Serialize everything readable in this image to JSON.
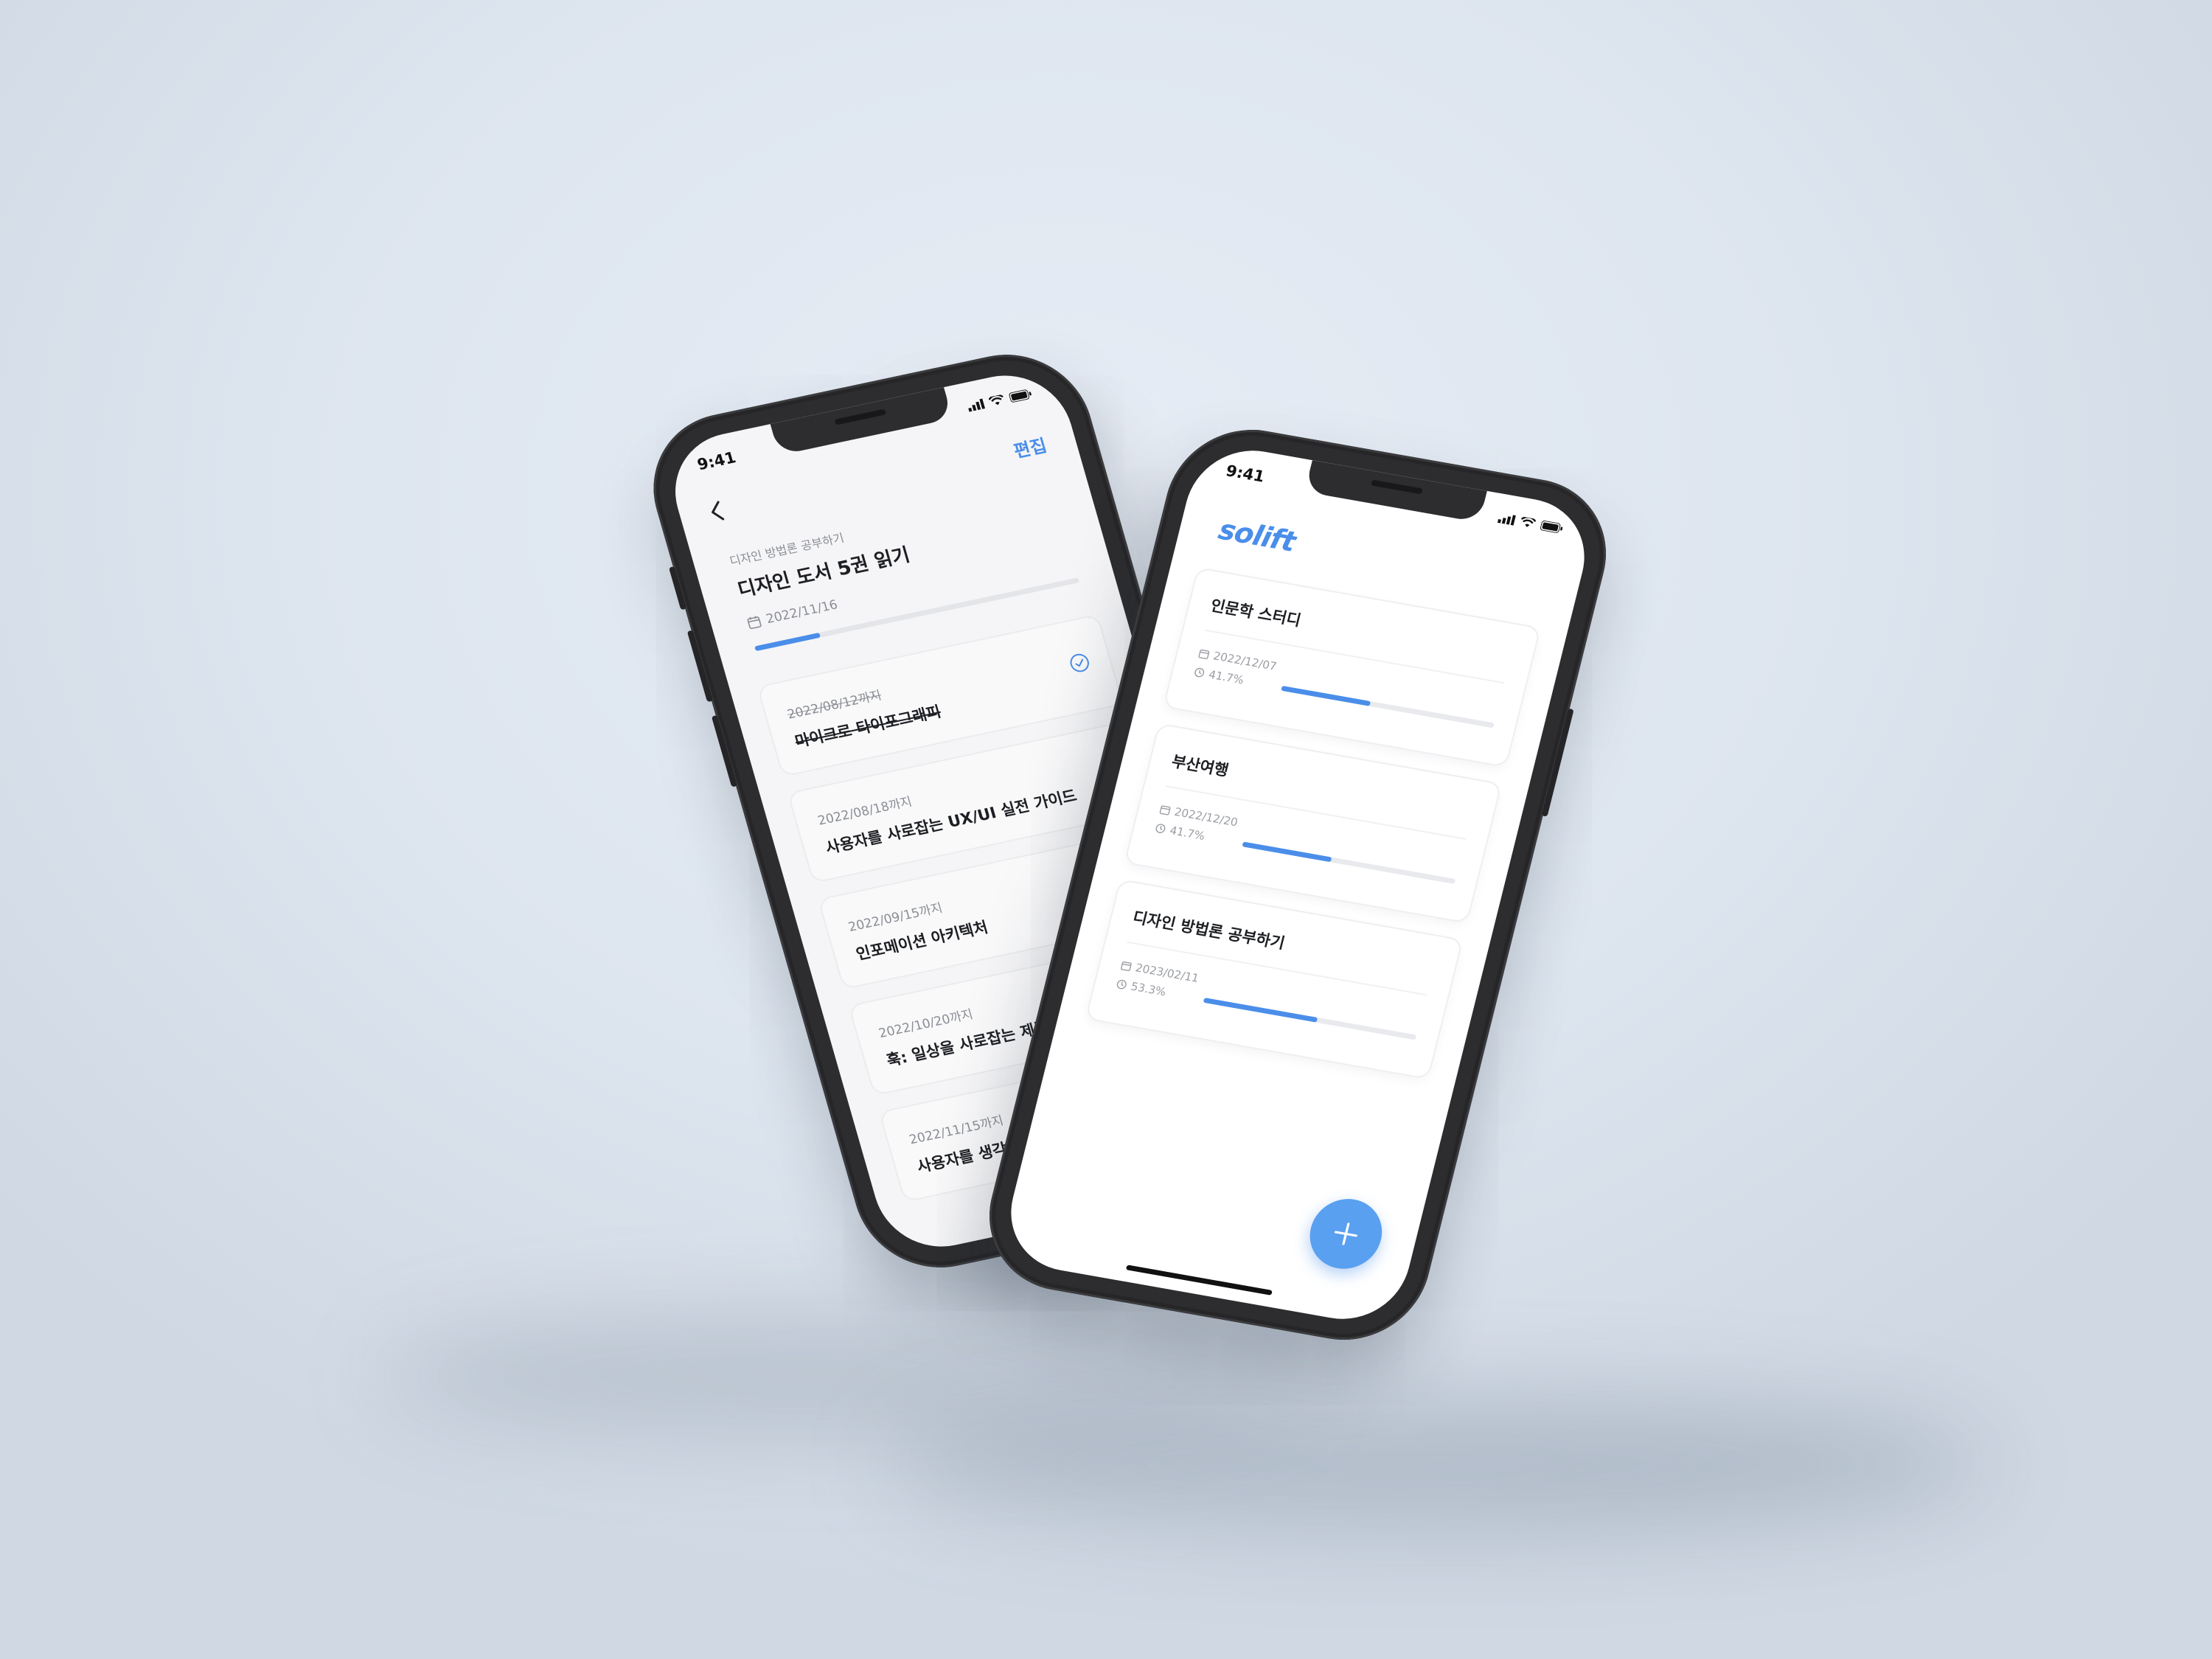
{
  "status_bar": {
    "time": "9:41"
  },
  "detail_screen": {
    "nav": {
      "edit_label": "편집"
    },
    "parent_goal": "디자인 방법론 공부하기",
    "title": "디자인 도서 5권 읽기",
    "date": "2022/11/16",
    "progress": 0.2,
    "books": [
      {
        "due": "2022/08/12까지",
        "name": "마이크로 타이포그래피",
        "done": true
      },
      {
        "due": "2022/08/18까지",
        "name": "사용자를 사로잡는 UX/UI 실전 가이드",
        "done": false
      },
      {
        "due": "2022/09/15까지",
        "name": "인포메이션 아키텍처",
        "done": false
      },
      {
        "due": "2022/10/20까지",
        "name": "훅: 일상을 사로잡는 제품의 비밀",
        "done": false
      },
      {
        "due": "2022/11/15까지",
        "name": "사용자를 생각하게 하지 마!",
        "done": false
      }
    ]
  },
  "list_screen": {
    "logo": "solift",
    "goals": [
      {
        "name": "인문학 스터디",
        "date": "2022/12/07",
        "percent_label": "41.7%",
        "progress": 0.417
      },
      {
        "name": "부산여행",
        "date": "2022/12/20",
        "percent_label": "41.7%",
        "progress": 0.417
      },
      {
        "name": "디자인 방법론 공부하기",
        "date": "2023/02/11",
        "percent_label": "53.3%",
        "progress": 0.533
      }
    ]
  },
  "colors": {
    "accent": "#4a8eea",
    "fab": "#5aa0f0",
    "phone_frame": "#2d2d2f"
  },
  "icons": {
    "back": "chevron-left-icon",
    "calendar": "calendar-icon",
    "check": "check-circle-icon",
    "clock": "clock-icon",
    "add": "plus-icon"
  }
}
